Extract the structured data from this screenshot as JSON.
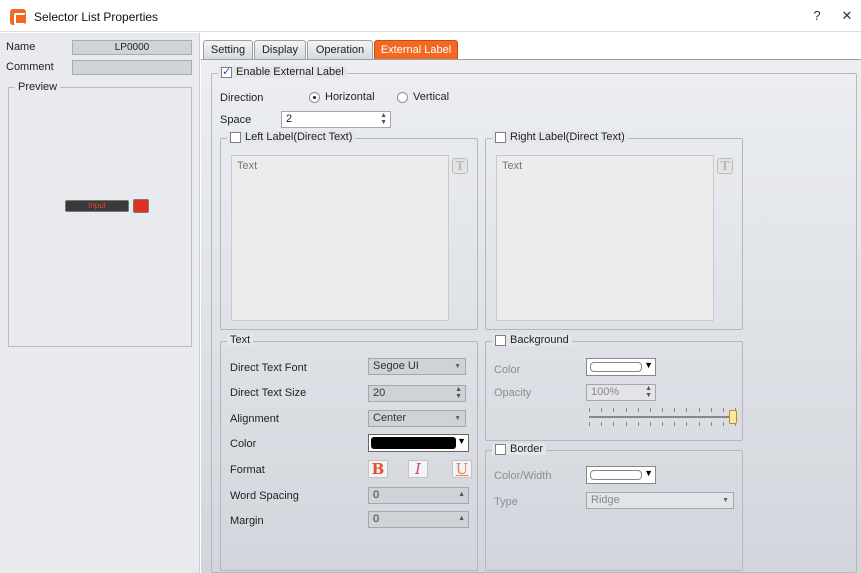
{
  "window": {
    "title": "Selector List Properties",
    "help": "?",
    "close": "✕"
  },
  "left": {
    "name_label": "Name",
    "name_value": "LP0000",
    "comment_label": "Comment",
    "comment_value": "",
    "preview_label": "Preview",
    "preview_widget_text": "Input"
  },
  "tabs": [
    {
      "label": "Setting"
    },
    {
      "label": "Display"
    },
    {
      "label": "Operation"
    },
    {
      "label": "External Label",
      "active": true
    }
  ],
  "external_label": {
    "enable_label": "Enable External Label",
    "enabled": true,
    "direction_label": "Direction",
    "horizontal_label": "Horizontal",
    "vertical_label": "Vertical",
    "direction_value": "Horizontal",
    "space_label": "Space",
    "space_value": "2",
    "left_label": {
      "title": "Left Label(Direct Text)",
      "checked": false,
      "placeholder": "Text",
      "icon": "text-style-icon"
    },
    "right_label": {
      "title": "Right Label(Direct Text)",
      "checked": false,
      "placeholder": "Text",
      "icon": "text-style-icon"
    }
  },
  "text_group": {
    "title": "Text",
    "font_label": "Direct Text Font",
    "font_value": "Segoe UI",
    "size_label": "Direct Text Size",
    "size_value": "20",
    "alignment_label": "Alignment",
    "alignment_value": "Center",
    "color_label": "Color",
    "color_value": "#000000",
    "format_label": "Format",
    "bold": "B",
    "italic": "I",
    "underline": "U",
    "word_spacing_label": "Word Spacing",
    "word_spacing_value": "0",
    "margin_label": "Margin",
    "margin_value": "0"
  },
  "background_group": {
    "title": "Background",
    "checked": false,
    "color_label": "Color",
    "color_value": "#ffffff",
    "opacity_label": "Opacity",
    "opacity_value": "100%",
    "opacity_level": 1.0
  },
  "border_group": {
    "title": "Border",
    "checked": false,
    "color_width_label": "Color/Width",
    "color_value": "#ffffff",
    "type_label": "Type",
    "type_value": "Ridge"
  },
  "colors": {
    "accent": "#f26a21"
  }
}
